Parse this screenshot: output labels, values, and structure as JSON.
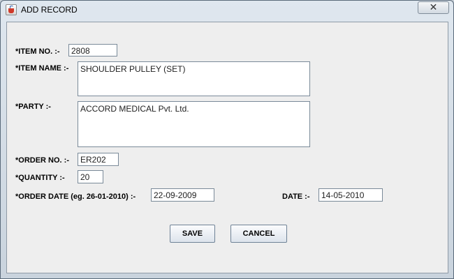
{
  "window": {
    "title": "ADD RECORD",
    "close_glyph": "✕",
    "icon": "java-cup-icon"
  },
  "form": {
    "item_no": {
      "label": "*ITEM NO. :-",
      "value": "2808"
    },
    "item_name": {
      "label": "*ITEM NAME :-",
      "value": "SHOULDER PULLEY (SET)"
    },
    "party": {
      "label": "*PARTY :-",
      "value": "ACCORD MEDICAL Pvt. Ltd."
    },
    "order_no": {
      "label": "*ORDER NO. :-",
      "value": "ER202"
    },
    "quantity": {
      "label": "*QUANTITY :-",
      "value": "20"
    },
    "order_date": {
      "label": "*ORDER DATE (eg. 26-01-2010) :-",
      "value": "22-09-2009"
    },
    "date": {
      "label": "DATE :-",
      "value": "14-05-2010"
    }
  },
  "buttons": {
    "save": "SAVE",
    "cancel": "CANCEL"
  }
}
